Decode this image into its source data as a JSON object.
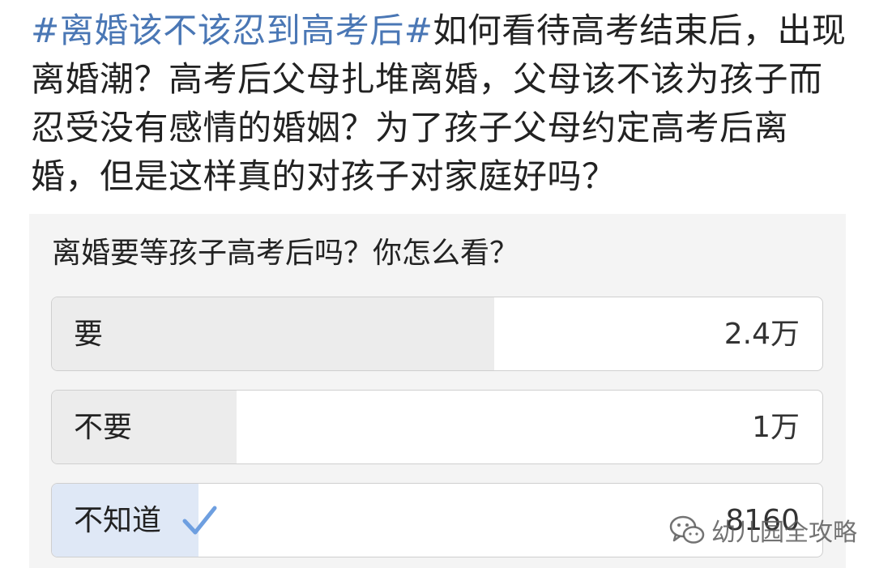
{
  "post": {
    "hashtag": "#离婚该不该忍到高考后#",
    "text": "如何看待高考结束后，出现离婚潮？高考后父母扎堆离婚，父母该不该为孩子而忍受没有感情的婚姻？为了孩子父母约定高考后离婚，但是这样真的对孩子对家庭好吗？"
  },
  "vote": {
    "question": "离婚要等孩子高考后吗？你怎么看？",
    "options": [
      {
        "label": "要",
        "count": "2.4万",
        "share": 0.5745
      },
      {
        "label": "不要",
        "count": "1万",
        "share": 0.24
      },
      {
        "label": "不知道",
        "count": "8160",
        "share": 0.19,
        "selected": true
      }
    ]
  },
  "watermark": {
    "text": "幼儿园全攻略",
    "icon": "wechat-icon"
  },
  "colors": {
    "hashtag": "#4a77b5",
    "fill_default": "#ececec",
    "fill_selected": "#dfe8f6",
    "check": "#6e9fe0"
  }
}
